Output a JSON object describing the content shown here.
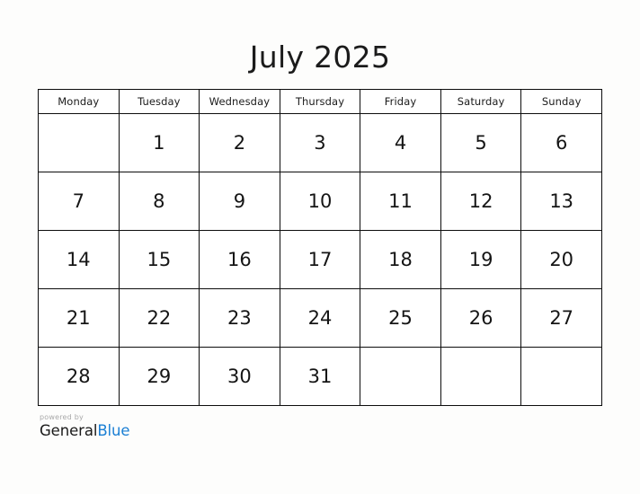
{
  "calendar": {
    "title": "July 2025",
    "month": "July",
    "year": "2025",
    "week_start": "Monday",
    "weekdays": [
      "Monday",
      "Tuesday",
      "Wednesday",
      "Thursday",
      "Friday",
      "Saturday",
      "Sunday"
    ],
    "weeks": [
      [
        "",
        "1",
        "2",
        "3",
        "4",
        "5",
        "6"
      ],
      [
        "7",
        "8",
        "9",
        "10",
        "11",
        "12",
        "13"
      ],
      [
        "14",
        "15",
        "16",
        "17",
        "18",
        "19",
        "20"
      ],
      [
        "21",
        "22",
        "23",
        "24",
        "25",
        "26",
        "27"
      ],
      [
        "28",
        "29",
        "30",
        "31",
        "",
        "",
        ""
      ]
    ]
  },
  "footer": {
    "powered_by": "powered by",
    "brand_first": "General",
    "brand_second": "Blue"
  },
  "colors": {
    "page_background": "#fdfdfc",
    "cell_background": "#ffffff",
    "grid_line": "#0d0d0d",
    "text": "#1b1b1b",
    "muted_text": "#a9a9a9",
    "brand_accent": "#1a7fd4"
  }
}
